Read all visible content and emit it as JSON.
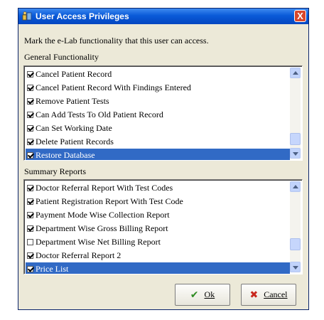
{
  "window": {
    "title": "User Access Privileges",
    "close_glyph": "X"
  },
  "instruction": "Mark the e-Lab functionality that this user can access.",
  "general": {
    "label": "General Functionality",
    "items": [
      {
        "label": "Cancel Patient Record",
        "checked": true,
        "selected": false
      },
      {
        "label": "Cancel Patient Record With Findings Entered",
        "checked": true,
        "selected": false
      },
      {
        "label": "Remove Patient Tests",
        "checked": true,
        "selected": false
      },
      {
        "label": "Can Add Tests To Old Patient Record",
        "checked": true,
        "selected": false
      },
      {
        "label": "Can Set Working Date",
        "checked": true,
        "selected": false
      },
      {
        "label": "Delete Patient Records",
        "checked": true,
        "selected": false
      },
      {
        "label": "Restore Database",
        "checked": true,
        "selected": true
      }
    ]
  },
  "summary": {
    "label": "Summary Reports",
    "items": [
      {
        "label": "Doctor Referral Report With Test Codes",
        "checked": true,
        "selected": false
      },
      {
        "label": "Patient Registration Report With Test Code",
        "checked": true,
        "selected": false
      },
      {
        "label": "Payment Mode Wise Collection Report",
        "checked": true,
        "selected": false
      },
      {
        "label": "Department Wise Gross Billing Report",
        "checked": true,
        "selected": false
      },
      {
        "label": "Department Wise Net Billing Report",
        "checked": false,
        "selected": false
      },
      {
        "label": "Doctor Referral Report 2",
        "checked": true,
        "selected": false
      },
      {
        "label": "Price List",
        "checked": true,
        "selected": true
      }
    ]
  },
  "buttons": {
    "ok_label": "Ok",
    "ok_icon": "checkmark-icon",
    "cancel_label": "Cancel",
    "cancel_icon": "x-icon"
  },
  "colors": {
    "titlebar": "#0a5ad8",
    "selection": "#316ac5",
    "dialog_bg": "#ece9d8"
  }
}
